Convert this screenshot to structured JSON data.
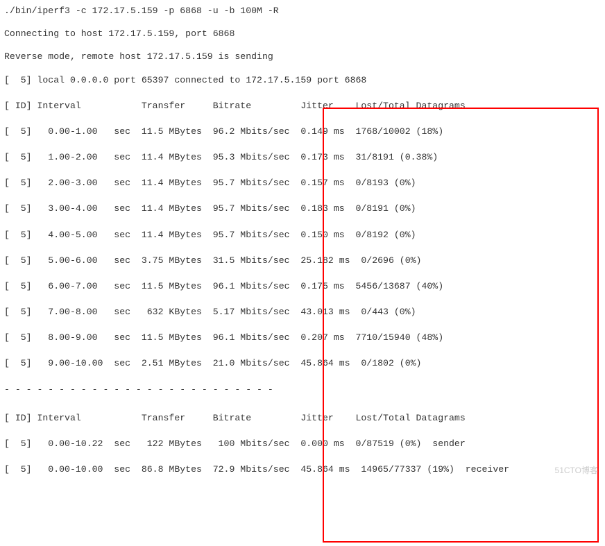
{
  "cmd": "./bin/iperf3 -c 172.17.5.159 -p 6868 -u -b 100M -R",
  "connecting": "Connecting to host 172.17.5.159, port 6868",
  "reverse": "Reverse mode, remote host 172.17.5.159 is sending",
  "local": "[  5] local 0.0.0.0 port 65397 connected to 172.17.5.159 port 6868",
  "header1": "[ ID] Interval           Transfer     Bitrate         Jitter    Lost/Total Datagrams",
  "rows": [
    "[  5]   0.00-1.00   sec  11.5 MBytes  96.2 Mbits/sec  0.149 ms  1768/10002 (18%)",
    "[  5]   1.00-2.00   sec  11.4 MBytes  95.3 Mbits/sec  0.173 ms  31/8191 (0.38%)",
    "[  5]   2.00-3.00   sec  11.4 MBytes  95.7 Mbits/sec  0.157 ms  0/8193 (0%)",
    "[  5]   3.00-4.00   sec  11.4 MBytes  95.7 Mbits/sec  0.183 ms  0/8191 (0%)",
    "[  5]   4.00-5.00   sec  11.4 MBytes  95.7 Mbits/sec  0.150 ms  0/8192 (0%)",
    "[  5]   5.00-6.00   sec  3.75 MBytes  31.5 Mbits/sec  25.182 ms  0/2696 (0%)",
    "[  5]   6.00-7.00   sec  11.5 MBytes  96.1 Mbits/sec  0.175 ms  5456/13687 (40%)",
    "[  5]   7.00-8.00   sec   632 KBytes  5.17 Mbits/sec  43.013 ms  0/443 (0%)",
    "[  5]   8.00-9.00   sec  11.5 MBytes  96.1 Mbits/sec  0.207 ms  7710/15940 (48%)",
    "[  5]   9.00-10.00  sec  2.51 MBytes  21.0 Mbits/sec  45.864 ms  0/1802 (0%)"
  ],
  "divider": "- - - - - - - - - - - - - - - - - - - - - - - - -",
  "header2": "[ ID] Interval           Transfer     Bitrate         Jitter    Lost/Total Datagrams",
  "summary": [
    "[  5]   0.00-10.22  sec   122 MBytes   100 Mbits/sec  0.000 ms  0/87519 (0%)  sender",
    "[  5]   0.00-10.00  sec  86.8 MBytes  72.9 Mbits/sec  45.864 ms  14965/77337 (19%)  receiver"
  ],
  "watermark": "51CTO博客"
}
